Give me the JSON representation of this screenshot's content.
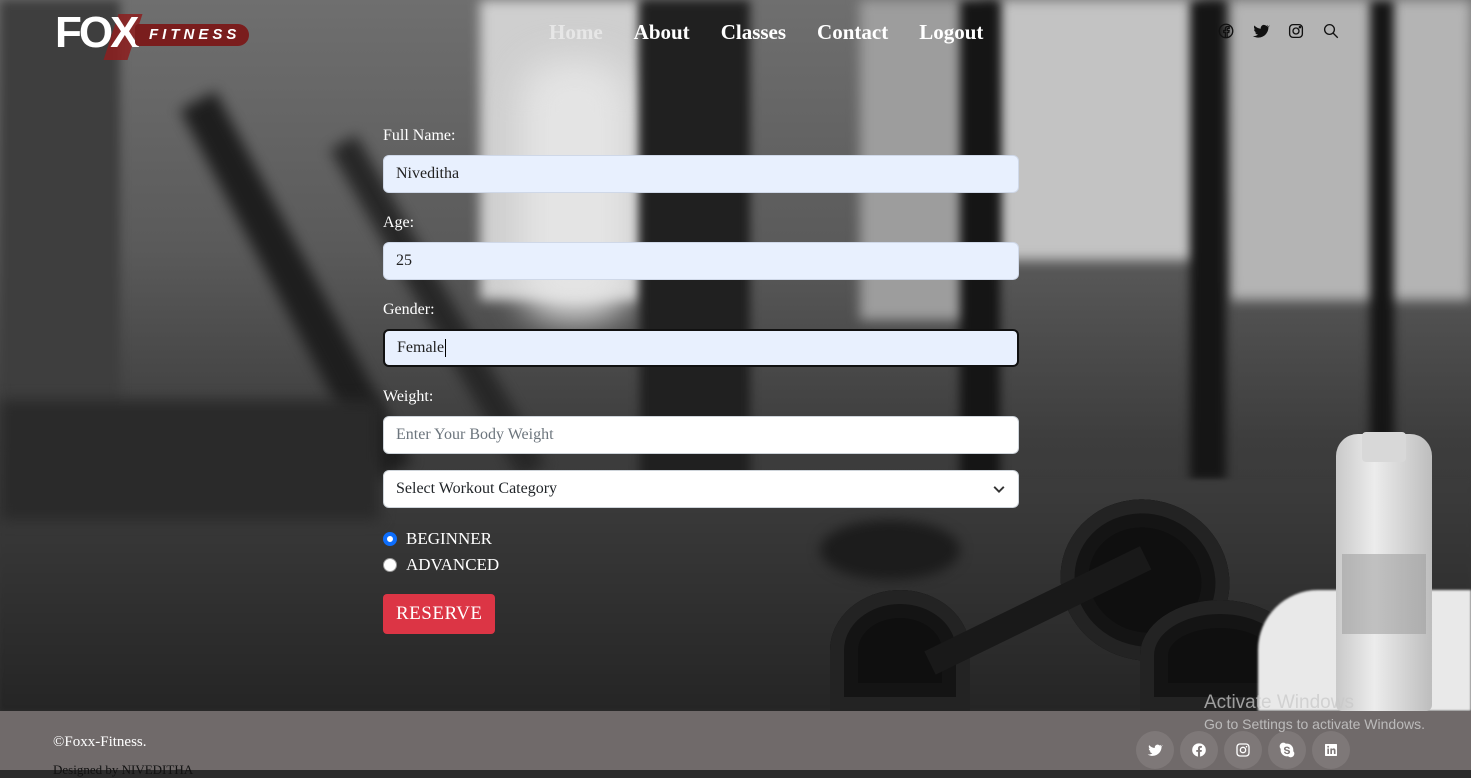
{
  "brand": {
    "logo_main": "FOX",
    "logo_tag": "FITNESS"
  },
  "nav": [
    {
      "label": "Home"
    },
    {
      "label": "About"
    },
    {
      "label": "Classes"
    },
    {
      "label": "Contact"
    },
    {
      "label": "Logout"
    }
  ],
  "header_icons": [
    "facebook-icon",
    "twitter-icon",
    "instagram-icon",
    "search-icon"
  ],
  "form": {
    "full_name": {
      "label": "Full Name:",
      "value": "Niveditha"
    },
    "age": {
      "label": "Age:",
      "value": "25"
    },
    "gender": {
      "label": "Gender:",
      "value": "Female"
    },
    "weight": {
      "label": "Weight:",
      "placeholder": "Enter Your Body Weight",
      "value": ""
    },
    "workout_select": {
      "selected": "Select Workout Category"
    },
    "levels": [
      {
        "label": "BEGINNER",
        "checked": true
      },
      {
        "label": "ADVANCED",
        "checked": false
      }
    ],
    "submit_label": "RESERVE"
  },
  "footer": {
    "copyright": "©Foxx-Fitness.",
    "designed_prefix": "Designed by",
    "designed_by": "NIVEDITHA",
    "social_icons": [
      "twitter-icon",
      "facebook-icon",
      "instagram-icon",
      "skype-icon",
      "linkedin-icon"
    ]
  },
  "os_overlay": {
    "title": "Activate Windows",
    "subtitle": "Go to Settings to activate Windows."
  },
  "colors": {
    "accent_button": "#dc3545",
    "radio_checked": "#0d6efd",
    "footer_bg": "#706a6a",
    "autofill_bg": "#e8f0fe",
    "logo_red": "#7a1d1d"
  }
}
